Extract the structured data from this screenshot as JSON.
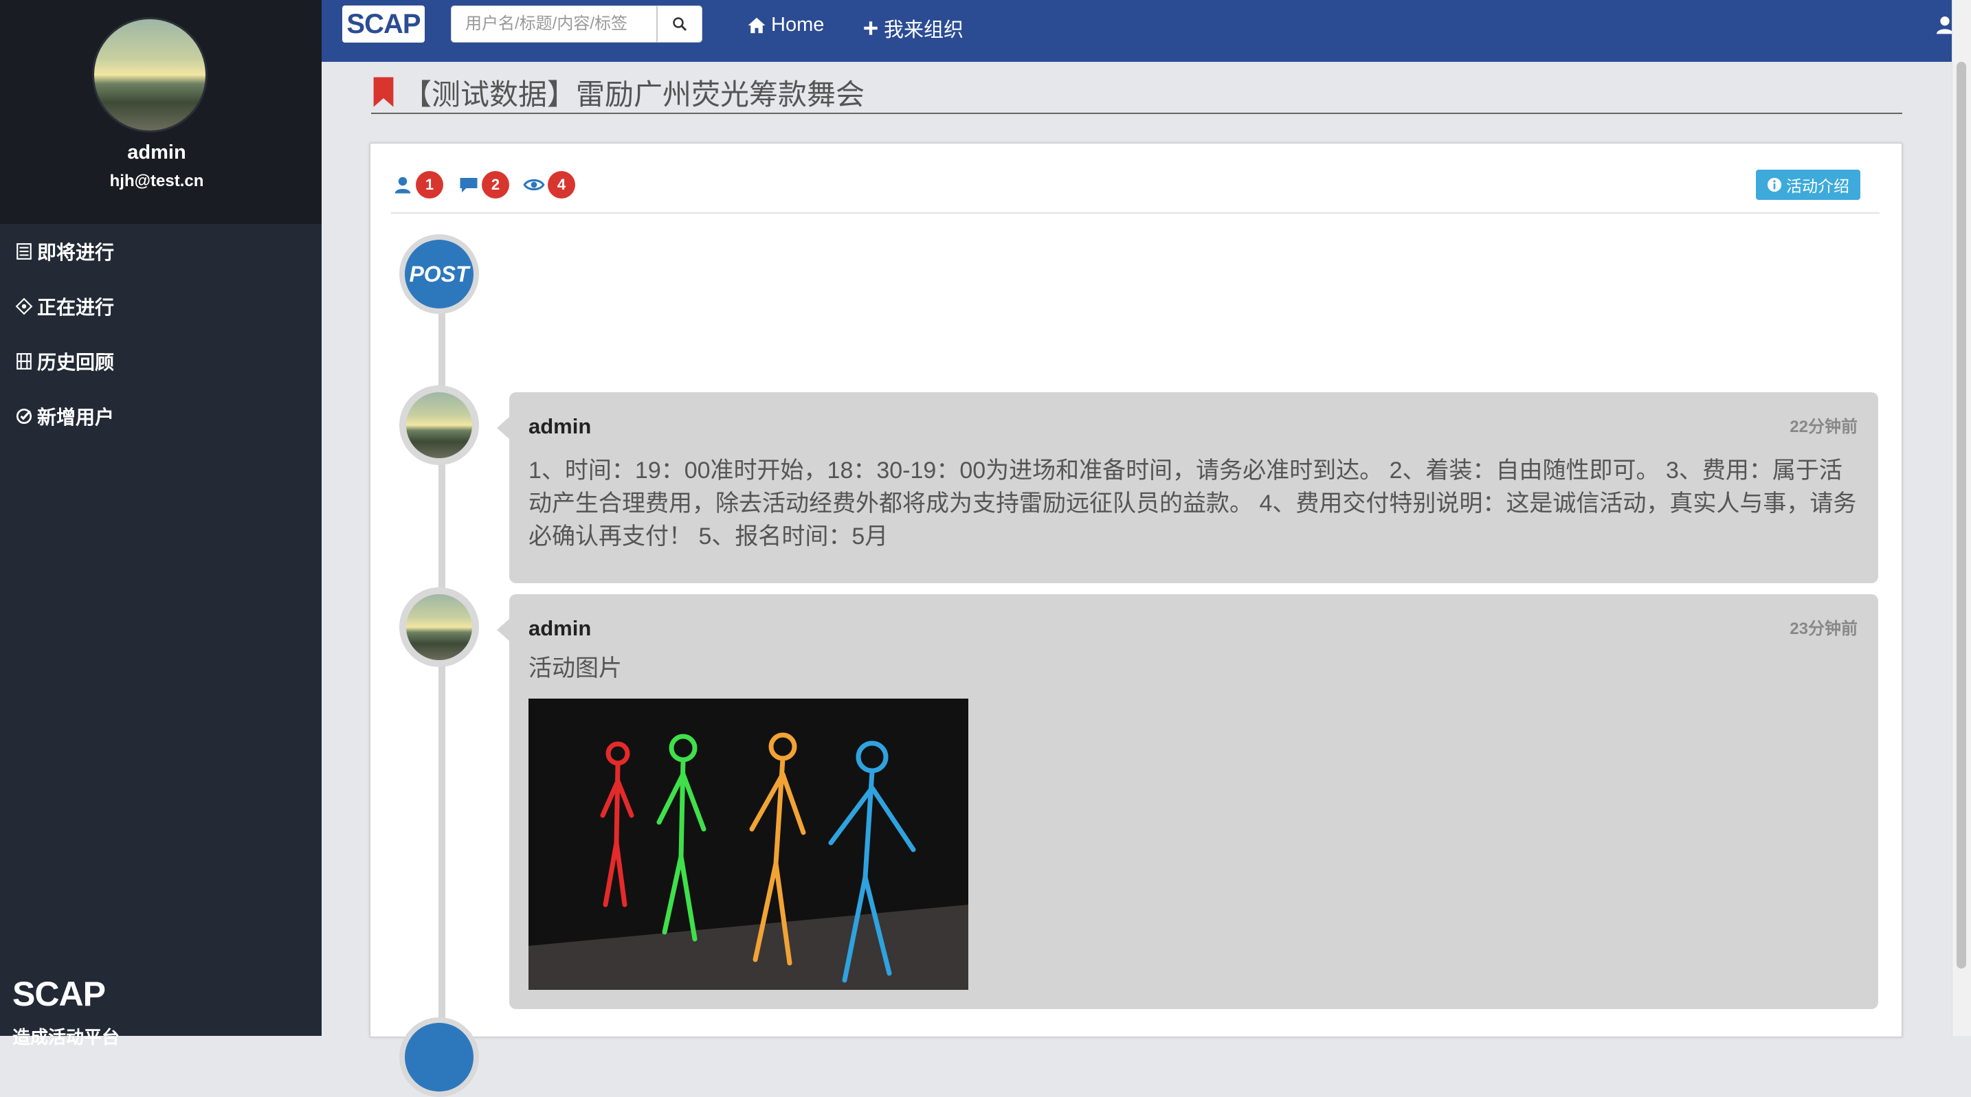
{
  "profile": {
    "name": "admin",
    "email": "hjh@test.cn"
  },
  "sidebar": {
    "items": [
      {
        "label": "即将进行",
        "icon": "list-icon"
      },
      {
        "label": "正在进行",
        "icon": "crosshair-icon"
      },
      {
        "label": "历史回顾",
        "icon": "film-icon"
      },
      {
        "label": "新增用户",
        "icon": "check-circle-icon"
      }
    ],
    "brand": "SCAP",
    "brand_sub": "造成活动平台"
  },
  "topbar": {
    "logo": "SCAP",
    "search_placeholder": "用户名/标题/内容/标签",
    "home_label": "Home",
    "organize_label": "我来组织"
  },
  "event": {
    "title": "【测试数据】雷励广州荧光筹款舞会",
    "stats": {
      "participants": "1",
      "comments": "2",
      "views": "4"
    },
    "intro_button": "活动介绍",
    "post_label": "POST"
  },
  "posts": [
    {
      "author": "admin",
      "time": "22分钟前",
      "body": "1、时间：19：00准时开始，18：30-19：00为进场和准备时间，请务必准时到达。 2、着装：自由随性即可。 3、费用：属于活动产生合理费用，除去活动经费外都将成为支持雷励远征队员的益款。 4、费用交付特别说明：这是诚信活动，真实人与事，请务必确认再支付！ 5、报名时间：5月"
    },
    {
      "author": "admin",
      "time": "23分钟前",
      "body": "活动图片"
    }
  ],
  "colors": {
    "topbar": "#2b4c93",
    "sidebar": "#232a36",
    "badge": "#d9352f",
    "accent": "#3daadb",
    "post": "#2d78bd"
  }
}
